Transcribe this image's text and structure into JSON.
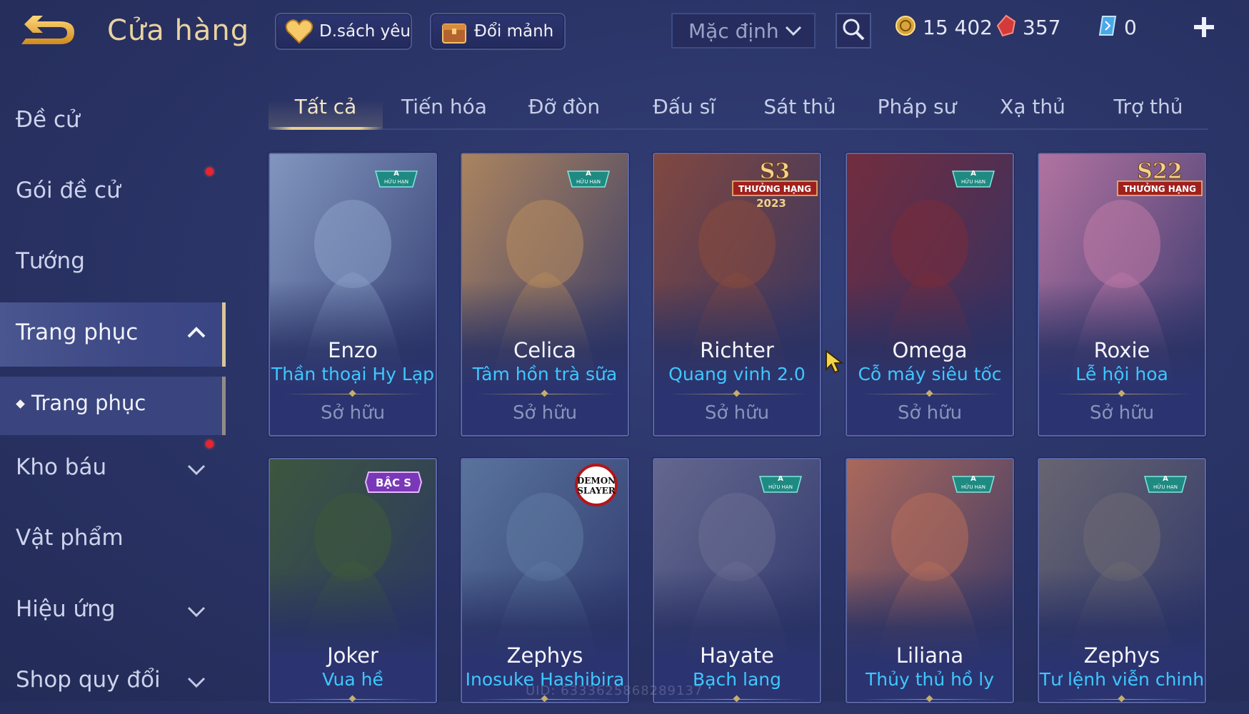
{
  "header": {
    "title": "Cửa hàng",
    "favorites_label": "D.sách yêu",
    "fragments_label": "Đổi mảnh",
    "sort_label": "Mặc định",
    "currencies": [
      {
        "icon": "coin-icon",
        "value": "15 402"
      },
      {
        "icon": "ruby-icon",
        "value": "357"
      },
      {
        "icon": "voucher-icon",
        "value": "0"
      }
    ]
  },
  "sidebar": {
    "items": [
      {
        "label": "Đề cử"
      },
      {
        "label": "Gói đề cử"
      },
      {
        "label": "Tướng"
      },
      {
        "label": "Trang phục"
      },
      {
        "label": "Trang phục"
      },
      {
        "label": "Kho báu"
      },
      {
        "label": "Vật phẩm"
      },
      {
        "label": "Hiệu ứng"
      },
      {
        "label": "Shop quy đổi"
      }
    ]
  },
  "tabs": [
    "Tất cả",
    "Tiến hóa",
    "Đỡ đòn",
    "Đấu sĩ",
    "Sát thủ",
    "Pháp sư",
    "Xạ thủ",
    "Trợ thủ"
  ],
  "badges": {
    "limited_top": "A",
    "limited_bottom": "HỮU HẠN",
    "season_s3": "S3",
    "season_s22": "S22",
    "ranked": "THƯỞNG HẠNG",
    "year": "2023",
    "tier": "BẬC S",
    "demon_slayer": "DEMON SLAYER"
  },
  "cards": [
    {
      "hero": "Enzo",
      "skin": "Thần thoại Hy Lạp",
      "status": "Sở hữu",
      "color": "#8aa0c8"
    },
    {
      "hero": "Celica",
      "skin": "Tâm hồn trà sữa",
      "status": "Sở hữu",
      "color": "#b88c5e"
    },
    {
      "hero": "Richter",
      "skin": "Quang vinh 2.0",
      "status": "Sở hữu",
      "color": "#8a4a3c"
    },
    {
      "hero": "Omega",
      "skin": "Cỗ máy siêu tốc",
      "status": "Sở hữu",
      "color": "#7a2c3a"
    },
    {
      "hero": "Roxie",
      "skin": "Lễ hội hoa",
      "status": "Sở hữu",
      "color": "#c07aa6"
    },
    {
      "hero": "Joker",
      "skin": "Vua hề",
      "color": "#3e5a3a"
    },
    {
      "hero": "Zephys",
      "skin": "Inosuke Hashibira",
      "color": "#5e7aa2"
    },
    {
      "hero": "Hayate",
      "skin": "Bạch lang",
      "color": "#6a6d92"
    },
    {
      "hero": "Liliana",
      "skin": "Thủy thủ hồ ly",
      "color": "#b86e5a"
    },
    {
      "hero": "Zephys",
      "skin": "Tư lệnh viễn chinh",
      "color": "#6e6a72"
    }
  ],
  "uid_text": "UID: 6333625868289137"
}
